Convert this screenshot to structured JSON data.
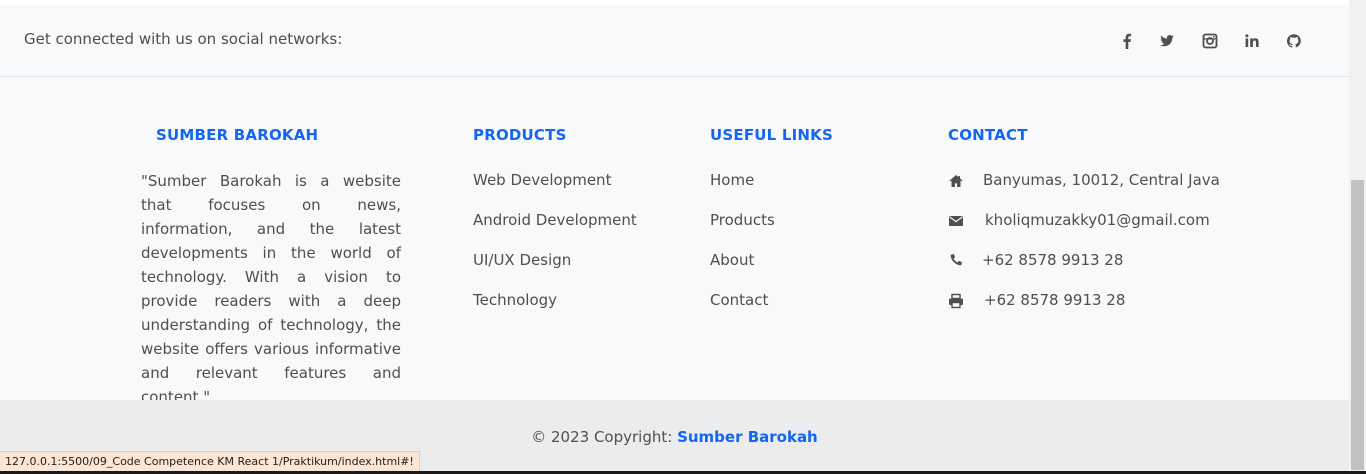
{
  "social": {
    "text": "Get connected with us on social networks:",
    "icons": [
      "facebook-icon",
      "twitter-icon",
      "instagram-icon",
      "linkedin-icon",
      "github-icon"
    ]
  },
  "brand": {
    "heading": "SUMBER BAROKAH",
    "description": "\"Sumber Barokah is a website that focuses on news, information, and the latest developments in the world of technology. With a vision to provide readers with a deep understanding of technology, the website offers various informative and relevant features and content.\""
  },
  "products": {
    "heading": "PRODUCTS",
    "items": [
      "Web Development",
      "Android Development",
      "UI/UX Design",
      "Technology"
    ]
  },
  "useful_links": {
    "heading": "USEFUL LINKS",
    "items": [
      "Home",
      "Products",
      "About",
      "Contact"
    ]
  },
  "contact": {
    "heading": "CONTACT",
    "address": "Banyumas, 10012, Central Java",
    "email": "kholiqmuzakky01@gmail.com",
    "phone": "+62 8578 9913 28",
    "fax": "+62 8578 9913 28"
  },
  "copyright": {
    "prefix": "© 2023 Copyright: ",
    "brand": "Sumber Barokah"
  },
  "status_url": "127.0.0.1:5500/09_Code Competence KM React 1/Praktikum/index.html#!",
  "colors": {
    "accent": "#1266f1",
    "text": "#4f4f4f",
    "footer_bg": "#f8f9fa",
    "copyright_bg": "#ebecee"
  }
}
